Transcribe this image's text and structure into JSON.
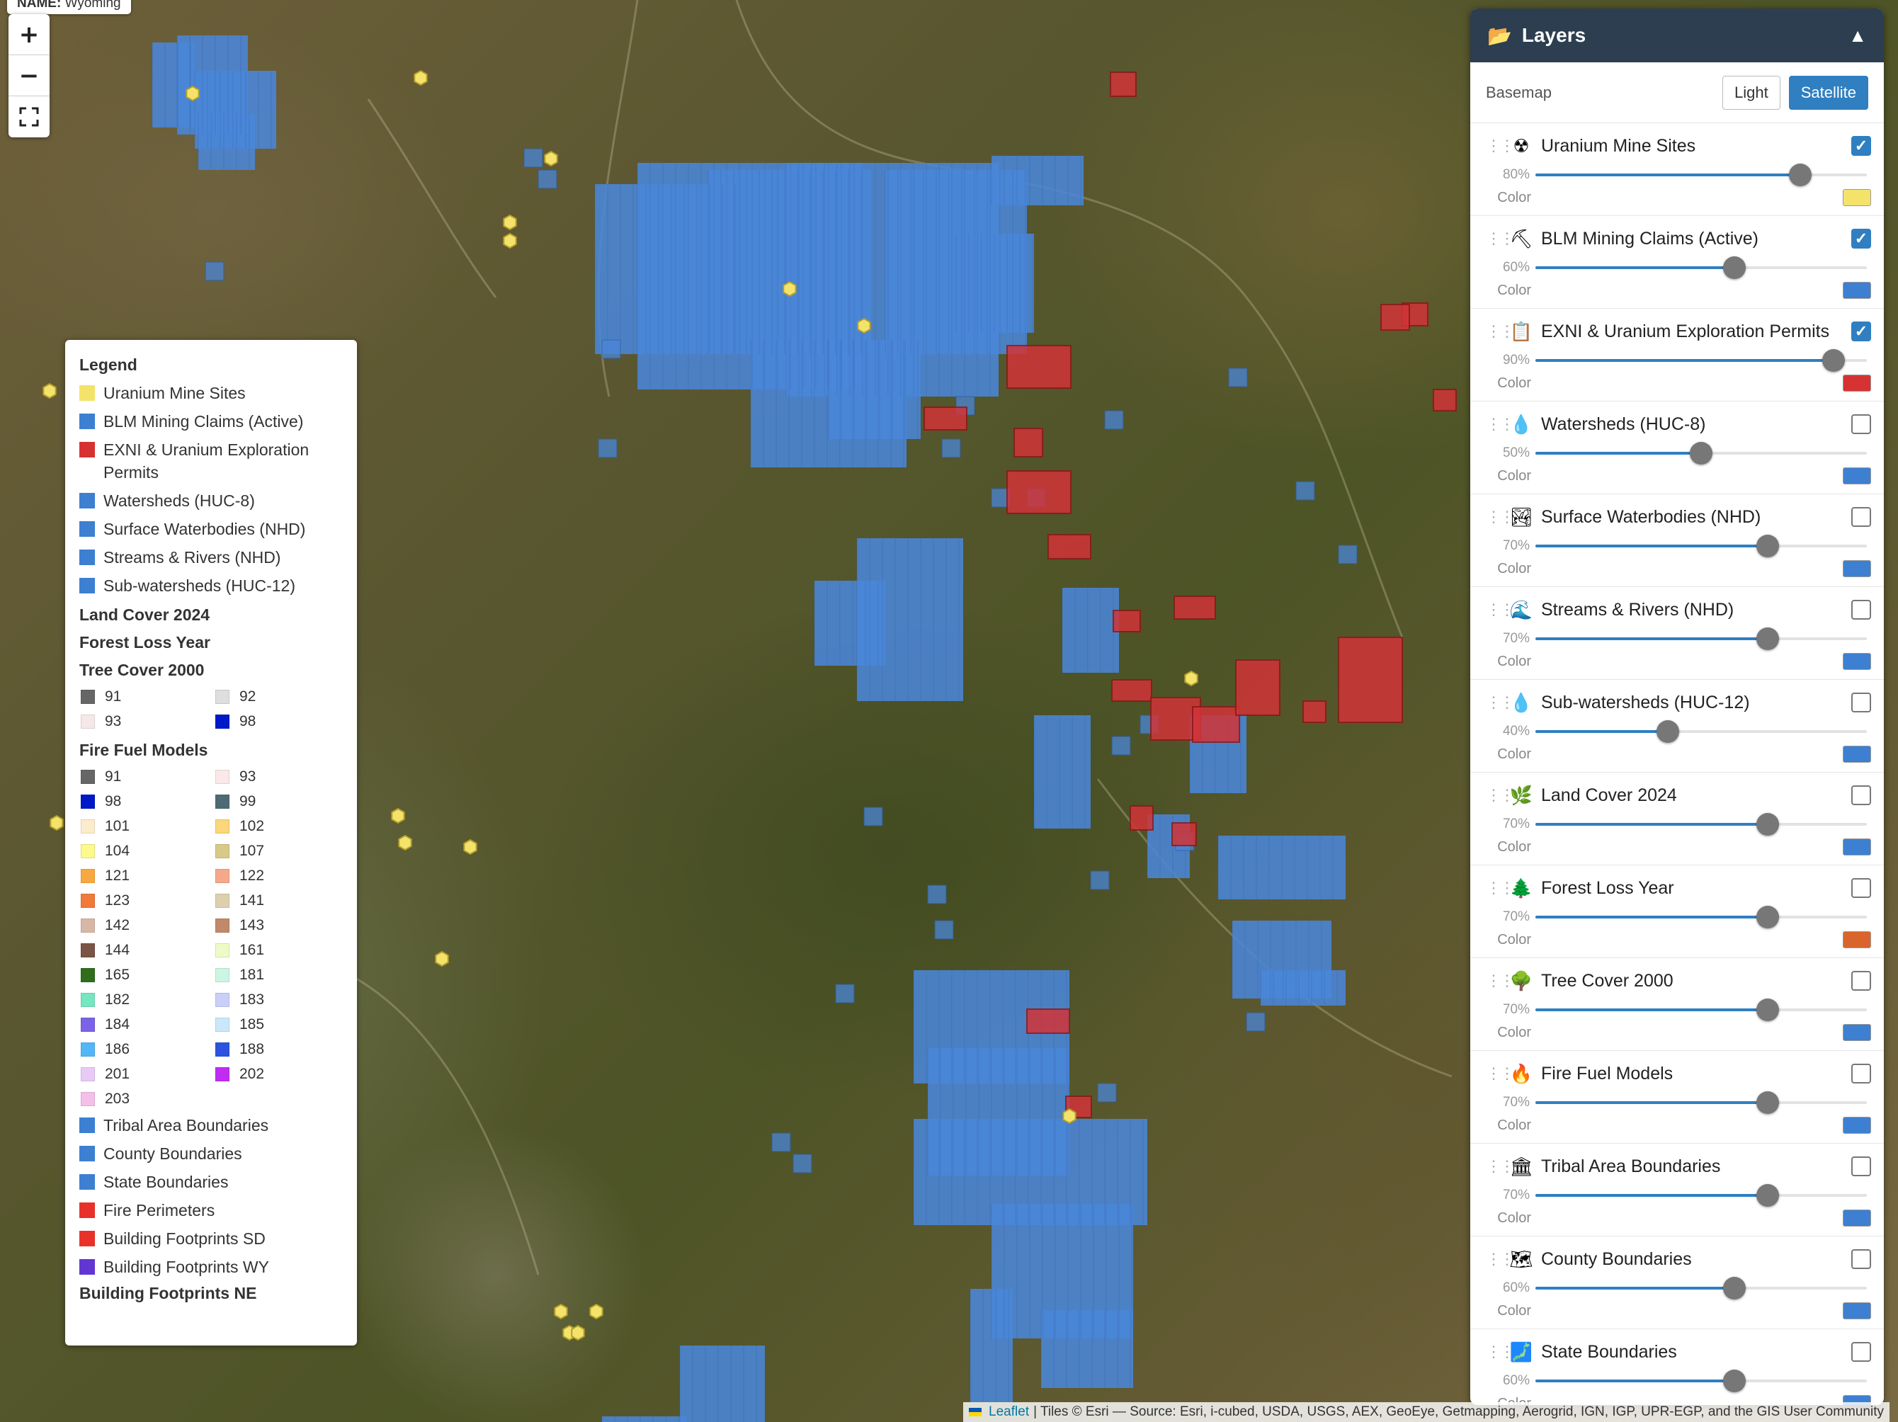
{
  "map": {
    "name_tooltip_key": "NAME:",
    "name_tooltip_value": "Wyoming",
    "zoom_in": "+",
    "zoom_out": "−",
    "fullscreen_icon": "fullscreen-icon",
    "colors": {
      "claims": "#4a86d8",
      "permits": "#d13438",
      "mines": "#f3e36a"
    }
  },
  "legend": {
    "title": "Legend",
    "items": [
      {
        "label": "Uranium Mine Sites",
        "color": "#f3e36a"
      },
      {
        "label": "BLM Mining Claims (Active)",
        "color": "#3d7fd1"
      },
      {
        "label": "EXNI & Uranium Exploration Permits",
        "color": "#d63232"
      },
      {
        "label": "Watersheds (HUC-8)",
        "color": "#3d7fd1"
      },
      {
        "label": "Surface Waterbodies (NHD)",
        "color": "#3d7fd1"
      },
      {
        "label": "Streams & Rivers (NHD)",
        "color": "#3d7fd1"
      },
      {
        "label": "Sub-watersheds (HUC-12)",
        "color": "#3d7fd1"
      }
    ],
    "section_land_cover": "Land Cover 2024",
    "section_forest_loss": "Forest Loss Year",
    "section_tree_cover": "Tree Cover 2000",
    "tree_cover": [
      {
        "label": "91",
        "color": "#666666"
      },
      {
        "label": "92",
        "color": "#dedede"
      },
      {
        "label": "93",
        "color": "#f6e8e8"
      },
      {
        "label": "98",
        "color": "#0019c8"
      }
    ],
    "section_fire_fuel": "Fire Fuel Models",
    "fire_fuel": [
      {
        "label": "91",
        "color": "#666666"
      },
      {
        "label": "93",
        "color": "#fbe9e9"
      },
      {
        "label": "98",
        "color": "#0019c8"
      },
      {
        "label": "99",
        "color": "#4d6b73"
      },
      {
        "label": "101",
        "color": "#fdeccc"
      },
      {
        "label": "102",
        "color": "#fbd67a"
      },
      {
        "label": "104",
        "color": "#fdf98a"
      },
      {
        "label": "107",
        "color": "#d7c987"
      },
      {
        "label": "121",
        "color": "#f7a940"
      },
      {
        "label": "122",
        "color": "#f5a98a"
      },
      {
        "label": "123",
        "color": "#f07a3a"
      },
      {
        "label": "141",
        "color": "#ddd0ae"
      },
      {
        "label": "142",
        "color": "#d7b7a5"
      },
      {
        "label": "143",
        "color": "#c08a6a"
      },
      {
        "label": "144",
        "color": "#7a5444"
      },
      {
        "label": "161",
        "color": "#eefbc8"
      },
      {
        "label": "165",
        "color": "#2e6e1c"
      },
      {
        "label": "181",
        "color": "#ccf6e3"
      },
      {
        "label": "182",
        "color": "#75e6bf"
      },
      {
        "label": "183",
        "color": "#c9cff8"
      },
      {
        "label": "184",
        "color": "#7a63e6"
      },
      {
        "label": "185",
        "color": "#cae8fa"
      },
      {
        "label": "186",
        "color": "#53b7f5"
      },
      {
        "label": "188",
        "color": "#2c53e0"
      },
      {
        "label": "201",
        "color": "#e7cbf6"
      },
      {
        "label": "202",
        "color": "#c02cf2"
      },
      {
        "label": "203",
        "color": "#f4bfe8"
      }
    ],
    "bottom_items": [
      {
        "label": "Tribal Area Boundaries",
        "color": "#3d7fd1"
      },
      {
        "label": "County Boundaries",
        "color": "#3d7fd1"
      },
      {
        "label": "State Boundaries",
        "color": "#3d7fd1"
      },
      {
        "label": "Fire Perimeters",
        "color": "#e8312b"
      },
      {
        "label": "Building Footprints SD",
        "color": "#e8312b"
      },
      {
        "label": "Building Footprints WY",
        "color": "#6236d2"
      }
    ],
    "section_bldg_ne": "Building Footprints NE"
  },
  "panel": {
    "title": "Layers",
    "folder_icon": "folder-open-icon",
    "collapse_glyph": "▲",
    "basemap_label": "Basemap",
    "basemap_options": [
      "Light",
      "Satellite"
    ],
    "basemap_selected": "Satellite",
    "color_label": "Color",
    "layers": [
      {
        "name": "Uranium Mine Sites",
        "icon": "☢",
        "icon_name": "radioactive-icon",
        "checked": true,
        "opacity": 80,
        "opacity_label": "80%",
        "color": "#f3e36a"
      },
      {
        "name": "BLM Mining Claims (Active)",
        "icon": "⛏",
        "icon_name": "pickaxe-icon",
        "checked": true,
        "opacity": 60,
        "opacity_label": "60%",
        "color": "#3d7fd1"
      },
      {
        "name": "EXNI & Uranium Exploration Permits",
        "icon": "📋",
        "icon_name": "clipboard-icon",
        "checked": true,
        "opacity": 90,
        "opacity_label": "90%",
        "color": "#d63232"
      },
      {
        "name": "Watersheds (HUC-8)",
        "icon": "💧",
        "icon_name": "droplet-icon",
        "checked": false,
        "opacity": 50,
        "opacity_label": "50%",
        "color": "#3d7fd1"
      },
      {
        "name": "Surface Waterbodies (NHD)",
        "icon": "🏞",
        "icon_name": "lake-icon",
        "checked": false,
        "opacity": 70,
        "opacity_label": "70%",
        "color": "#3d7fd1"
      },
      {
        "name": "Streams & Rivers (NHD)",
        "icon": "🌊",
        "icon_name": "wave-icon",
        "checked": false,
        "opacity": 70,
        "opacity_label": "70%",
        "color": "#3d7fd1"
      },
      {
        "name": "Sub-watersheds (HUC-12)",
        "icon": "💧",
        "icon_name": "droplet-icon",
        "checked": false,
        "opacity": 40,
        "opacity_label": "40%",
        "color": "#3d7fd1"
      },
      {
        "name": "Land Cover 2024",
        "icon": "🌿",
        "icon_name": "leaf-icon",
        "checked": false,
        "opacity": 70,
        "opacity_label": "70%",
        "color": "#3d7fd1"
      },
      {
        "name": "Forest Loss Year",
        "icon": "🌲",
        "icon_name": "evergreen-tree-icon",
        "checked": false,
        "opacity": 70,
        "opacity_label": "70%",
        "color": "#d9652c"
      },
      {
        "name": "Tree Cover 2000",
        "icon": "🌳",
        "icon_name": "tree-icon",
        "checked": false,
        "opacity": 70,
        "opacity_label": "70%",
        "color": "#3d7fd1"
      },
      {
        "name": "Fire Fuel Models",
        "icon": "🔥",
        "icon_name": "fire-icon",
        "checked": false,
        "opacity": 70,
        "opacity_label": "70%",
        "color": "#3d7fd1"
      },
      {
        "name": "Tribal Area Boundaries",
        "icon": "🏛",
        "icon_name": "building-columns-icon",
        "checked": false,
        "opacity": 70,
        "opacity_label": "70%",
        "color": "#3d7fd1"
      },
      {
        "name": "County Boundaries",
        "icon": "🗺",
        "icon_name": "map-icon",
        "checked": false,
        "opacity": 60,
        "opacity_label": "60%",
        "color": "#3d7fd1"
      },
      {
        "name": "State Boundaries",
        "icon": "🗾",
        "icon_name": "map-outline-icon",
        "checked": false,
        "opacity": 60,
        "opacity_label": "60%",
        "color": "#3d7fd1"
      }
    ]
  },
  "attribution": {
    "leaflet": "Leaflet",
    "text": "| Tiles © Esri — Source: Esri, i-cubed, USDA, USGS, AEX, GeoEye, Getmapping, Aerogrid, IGN, IGP, UPR-EGP, and the GIS User Community"
  }
}
